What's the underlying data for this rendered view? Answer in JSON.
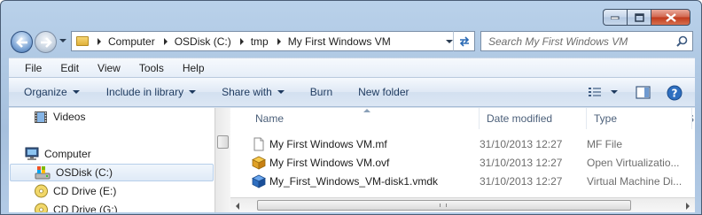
{
  "window": {
    "caption_buttons": [
      "minimize",
      "maximize",
      "close"
    ]
  },
  "address": {
    "crumbs": [
      "Computer",
      "OSDisk (C:)",
      "tmp",
      "My First Windows VM"
    ]
  },
  "search": {
    "placeholder": "Search My First Windows VM"
  },
  "menu": {
    "items": [
      "File",
      "Edit",
      "View",
      "Tools",
      "Help"
    ]
  },
  "commands": {
    "organize": "Organize",
    "include_in_library": "Include in library",
    "share_with": "Share with",
    "burn": "Burn",
    "new_folder": "New folder"
  },
  "navigation": {
    "items": [
      {
        "label": "Videos",
        "icon": "video-library-icon"
      },
      {
        "label": "Computer",
        "icon": "computer-icon"
      },
      {
        "label": "OSDisk (C:)",
        "icon": "system-drive-icon",
        "selected": true
      },
      {
        "label": "CD Drive (E:)",
        "icon": "cd-drive-icon"
      },
      {
        "label": "CD Drive (G:)",
        "icon": "cd-drive-icon"
      }
    ]
  },
  "file_list": {
    "columns": [
      "Name",
      "Date modified",
      "Type",
      "S"
    ],
    "rows": [
      {
        "name": "My First Windows VM.mf",
        "date": "31/10/2013 12:27",
        "type": "MF File",
        "icon": "text-file-icon"
      },
      {
        "name": "My First Windows VM.ovf",
        "date": "31/10/2013 12:27",
        "type": "Open Virtualizatio...",
        "icon": "ovf-package-icon"
      },
      {
        "name": "My_First_Windows_VM-disk1.vmdk",
        "date": "31/10/2013 12:27",
        "type": "Virtual Machine Di...",
        "icon": "vmdk-disk-icon"
      }
    ]
  },
  "colors": {
    "frame": "#b9d1ea",
    "command_bar": "#dfe9f5",
    "selection": "#dfeaf7",
    "close_button": "#c0391b"
  }
}
